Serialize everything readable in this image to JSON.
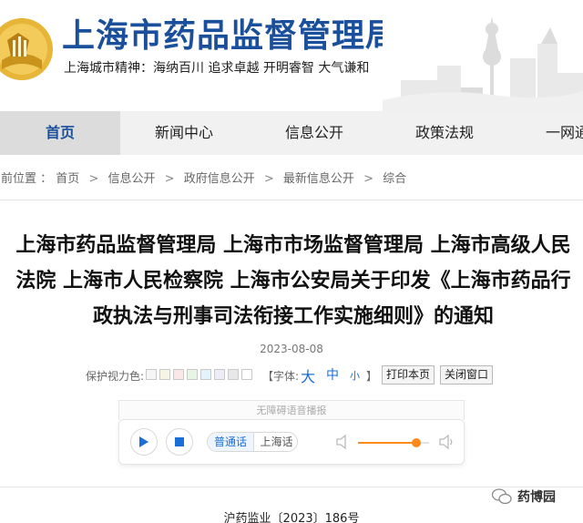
{
  "header": {
    "site_title": "上海市药品监督管理局",
    "slogan": "上海城市精神：海纳百川  追求卓越  开明睿智  大气谦和",
    "emblem_icon": "shanghai-emblem-icon",
    "brand_color": "#1a4f9c"
  },
  "nav": {
    "items": [
      {
        "label": "首页",
        "active": true
      },
      {
        "label": "新闻中心",
        "active": false
      },
      {
        "label": "信息公开",
        "active": false
      },
      {
        "label": "政策法规",
        "active": false
      },
      {
        "label": "一网通",
        "active": false
      }
    ]
  },
  "breadcrumb": {
    "prefix": "当前位置",
    "items": [
      "首页",
      "信息公开",
      "政府信息公开",
      "最新信息公开",
      "综合"
    ],
    "separator": ">"
  },
  "article": {
    "title": "上海市药品监督管理局 上海市市场监督管理局 上海市高级人民法院 上海市人民检察院 上海市公安局关于印发《上海市药品行政执法与刑事司法衔接工作实施细则》的通知",
    "date": "2023-08-08",
    "doc_number": "沪药监业〔2023〕186号"
  },
  "tools": {
    "eye_protection_label": "保护视力色:",
    "swatch_colors": [
      "#f5f5f5",
      "#f6f4e4",
      "#fbe7e7",
      "#e8f5e4",
      "#e3f3fb",
      "#ededf7",
      "#e8e8e8",
      "#ffffff"
    ],
    "font_label": "【字体:",
    "font_large": "大",
    "font_medium": "中",
    "font_small": "小",
    "font_close": "】",
    "print_button": "打印本页",
    "close_button": "关闭窗口"
  },
  "audio": {
    "header": "无障碍语音播报",
    "play_icon": "play-icon",
    "stop_icon": "stop-icon",
    "lang_mandarin": "普通话",
    "lang_shanghai": "上海话",
    "volume_level": 0.82,
    "accent_color": "#ff8a1c"
  },
  "watermark": {
    "text": "药博园"
  }
}
